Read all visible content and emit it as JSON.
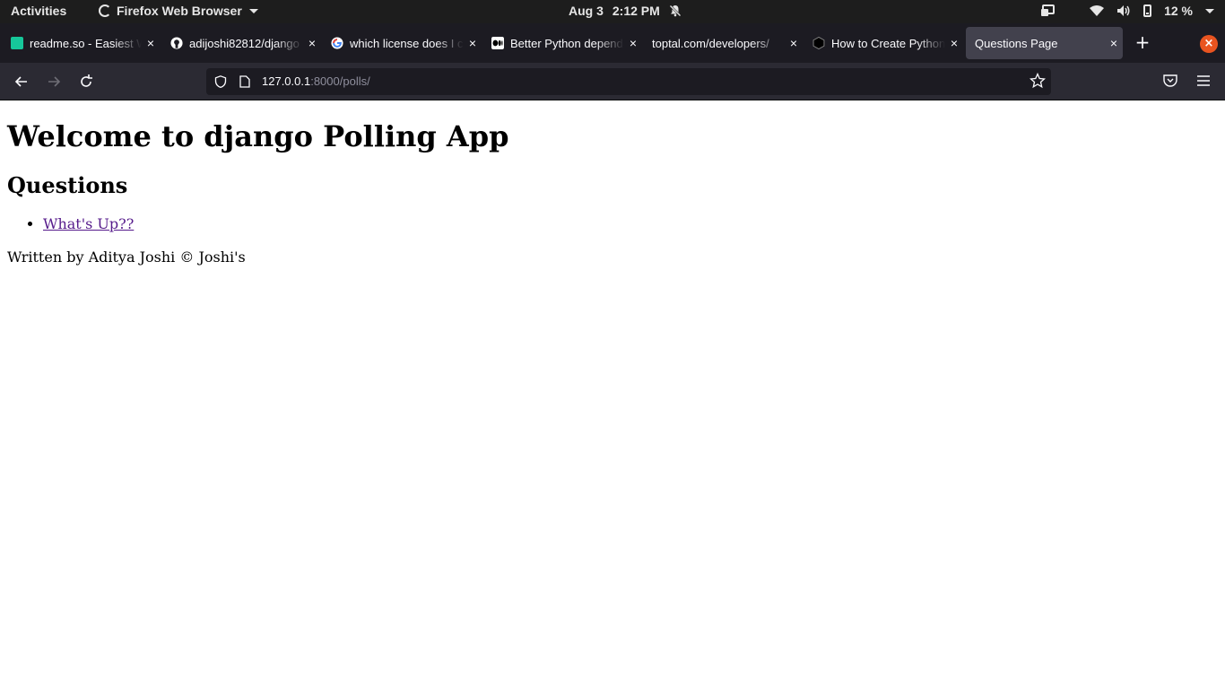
{
  "system_bar": {
    "activities": "Activities",
    "app_name": "Firefox Web Browser",
    "date": "Aug 3",
    "time": "2:12 PM",
    "battery": "12 %"
  },
  "tabs": [
    {
      "title": "readme.so - Easiest Way to Write a README",
      "favicon": "readme-so-icon",
      "favicon_color": "#16c79a"
    },
    {
      "title": "adijoshi82812/django",
      "favicon": "github-icon",
      "favicon_color": "#ffffff"
    },
    {
      "title": "which license does I choose",
      "favicon": "google-icon",
      "favicon_color": "#4285f4"
    },
    {
      "title": "Better Python dependency",
      "favicon": "medium-icon",
      "favicon_color": "#ffffff"
    },
    {
      "title": "toptal.com/developers/",
      "favicon": "",
      "favicon_color": ""
    },
    {
      "title": "How to Create Python",
      "favicon": "hexagon-icon",
      "favicon_color": "#000000"
    },
    {
      "title": "Questions Page",
      "favicon": "",
      "favicon_color": "",
      "active": true
    }
  ],
  "address_bar": {
    "host": "127.0.0.1",
    "rest": ":8000/polls/"
  },
  "page": {
    "heading": "Welcome to django Polling App",
    "subheading": "Questions",
    "questions": [
      "What's Up??"
    ],
    "footer": "Written by Aditya Joshi © Joshi's"
  },
  "colors": {
    "link_visited": "#551a8b",
    "accent_close": "#e95420"
  }
}
